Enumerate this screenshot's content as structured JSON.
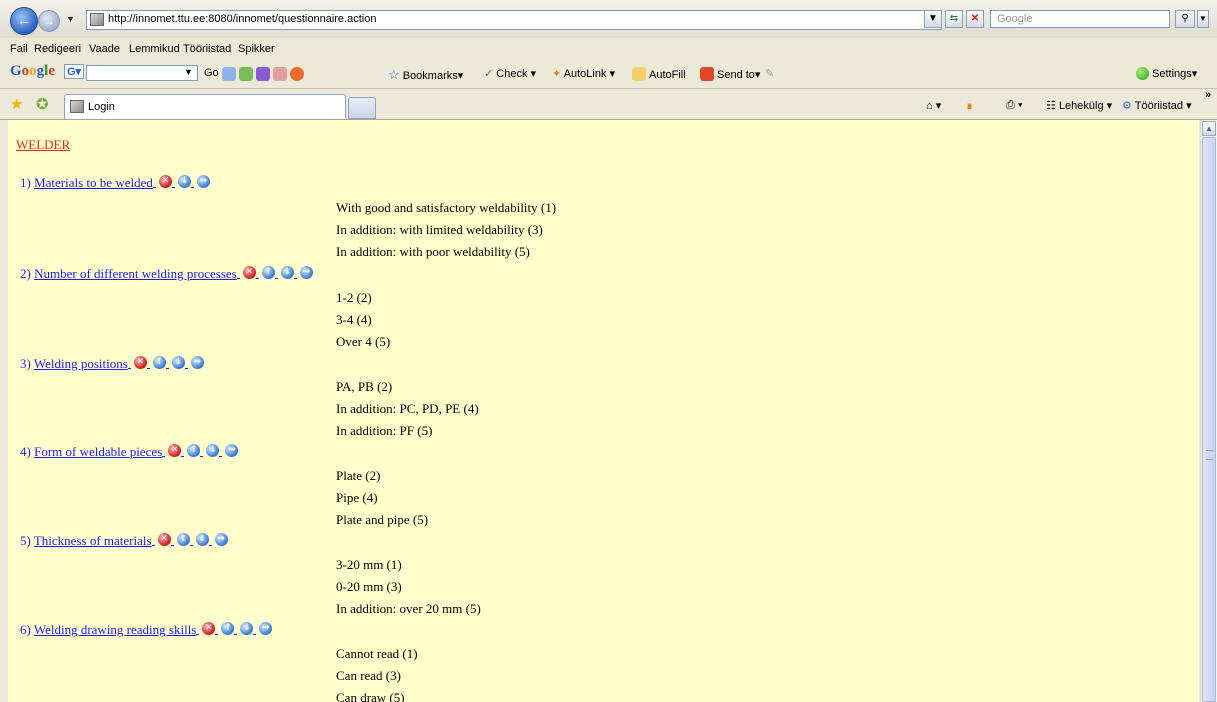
{
  "browser": {
    "url": "http://innomet.ttu.ee:8080/innomet/questionnaire.action",
    "search_placeholder": "Google",
    "menu": [
      "Fail",
      "Redigeeri",
      "Vaade",
      "Lemmikud",
      "Tööriistad",
      "Spikker"
    ],
    "google_toolbar": {
      "go": "Go",
      "bookmarks": "Bookmarks",
      "check": "Check",
      "autolink": "AutoLink",
      "autofill": "AutoFill",
      "sendto": "Send to",
      "settings": "Settings"
    },
    "tab_title": "Login",
    "right_tools": {
      "page": "Lehekülg",
      "tools": "Tööriistad"
    }
  },
  "page": {
    "heading": "WELDER",
    "questions": [
      {
        "num": "1)",
        "title": "Materials to be welded",
        "icons": [
          "delete-icon",
          "move-down-icon",
          "edit-icon"
        ],
        "answers": [
          "With good and satisfactory weldability (1)",
          "In addition: with limited weldability (3)",
          "In addition: with poor weldability (5)"
        ]
      },
      {
        "num": "2)",
        "title": "Number of different welding processes",
        "icons": [
          "delete-icon",
          "move-up-icon",
          "move-down-icon",
          "edit-icon"
        ],
        "answers": [
          "1-2 (2)",
          "3-4 (4)",
          "Over 4 (5)"
        ]
      },
      {
        "num": "3)",
        "title": "Welding positions",
        "icons": [
          "delete-icon",
          "move-up-icon",
          "move-down-icon",
          "edit-icon"
        ],
        "answers": [
          "PA, PB (2)",
          "In addition: PC, PD, PE (4)",
          "In addition: PF (5)"
        ]
      },
      {
        "num": "4)",
        "title": "Form of weldable pieces",
        "icons": [
          "delete-icon",
          "move-up-icon",
          "move-down-icon",
          "edit-icon"
        ],
        "answers": [
          "Plate (2)",
          "Pipe (4)",
          "Plate and pipe (5)"
        ]
      },
      {
        "num": "5)",
        "title": "Thickness of materials",
        "icons": [
          "delete-icon",
          "move-up-icon",
          "move-down-icon",
          "edit-icon"
        ],
        "answers": [
          "3-20 mm (1)",
          "0-20 mm (3)",
          "In addition: over 20 mm (5)"
        ]
      },
      {
        "num": "6)",
        "title": "Welding drawing reading skills",
        "icons": [
          "delete-icon",
          "move-up-icon",
          "move-down-icon",
          "edit-icon"
        ],
        "answers": [
          "Cannot read (1)",
          "Can read (3)",
          "Can draw (5)"
        ]
      }
    ]
  }
}
